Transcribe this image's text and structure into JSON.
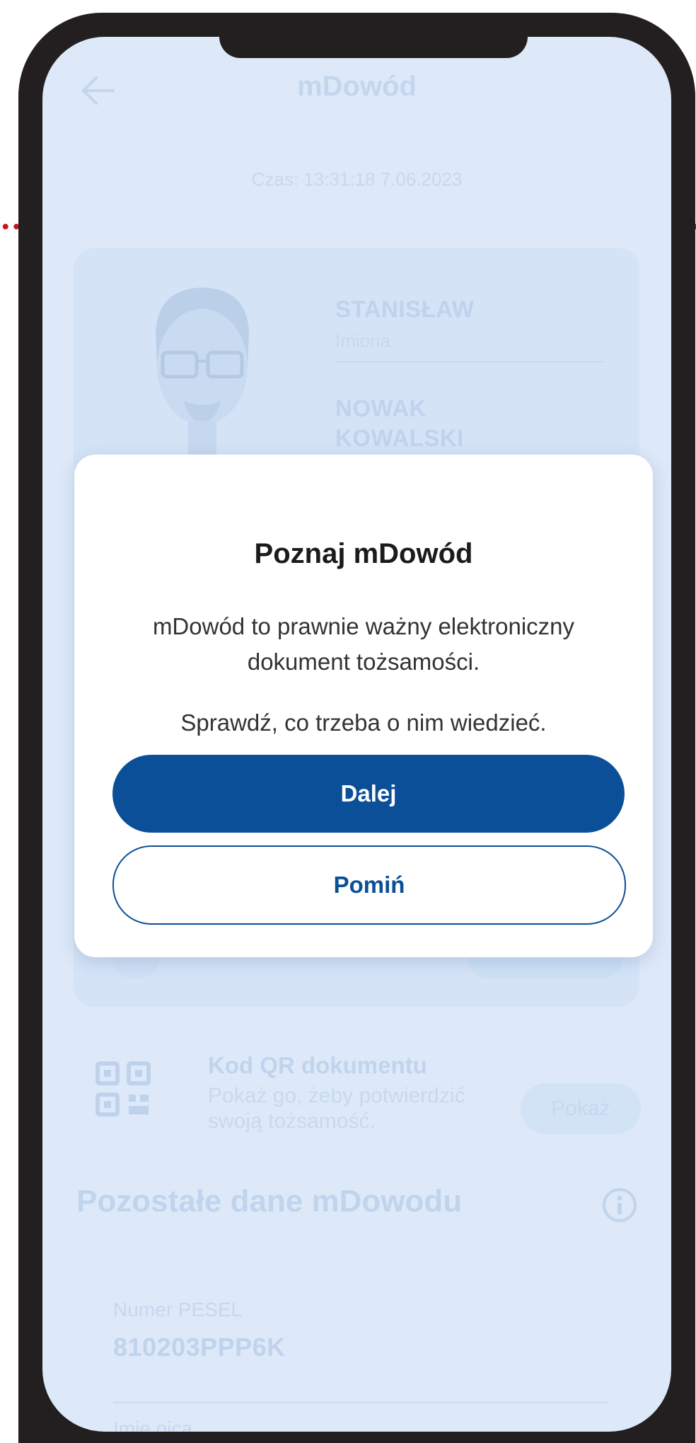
{
  "colors": {
    "frame": "#231f20",
    "screen_background": "#dde9f8",
    "primary_button": "#0a4f98",
    "dotted_line": "#c0161d",
    "modal_background": "#ffffff"
  },
  "app_header": {
    "back_icon": "arrow-left-icon",
    "title": "mDowód"
  },
  "time_text": "Czas: 13:31:18 7.06.2023",
  "id_card": {
    "fields": [
      {
        "value": "STANISŁAW",
        "label": "Imiona"
      },
      {
        "value_line1": "NOWAK",
        "value_line2": "KOWALSKI"
      }
    ]
  },
  "qr_section": {
    "icon": "qr-code-icon",
    "title": "Kod QR dokumentu",
    "description": "Pokaż go, żeby potwierdzić swoją tożsamość.",
    "button_label": "Pokaż"
  },
  "other_data": {
    "section_title": "Pozostałe dane mDowodu",
    "info_icon": "info-icon",
    "items": [
      {
        "label": "Numer PESEL",
        "value": "810203PPP6K"
      },
      {
        "label": "Imię ojca"
      }
    ]
  },
  "modal": {
    "title": "Poznaj mDowód",
    "paragraph1": "mDowód to prawnie ważny elektroniczny dokument tożsamości.",
    "paragraph2": "Sprawdź, co trzeba o nim wiedzieć.",
    "primary_button": "Dalej",
    "secondary_button": "Pomiń"
  }
}
